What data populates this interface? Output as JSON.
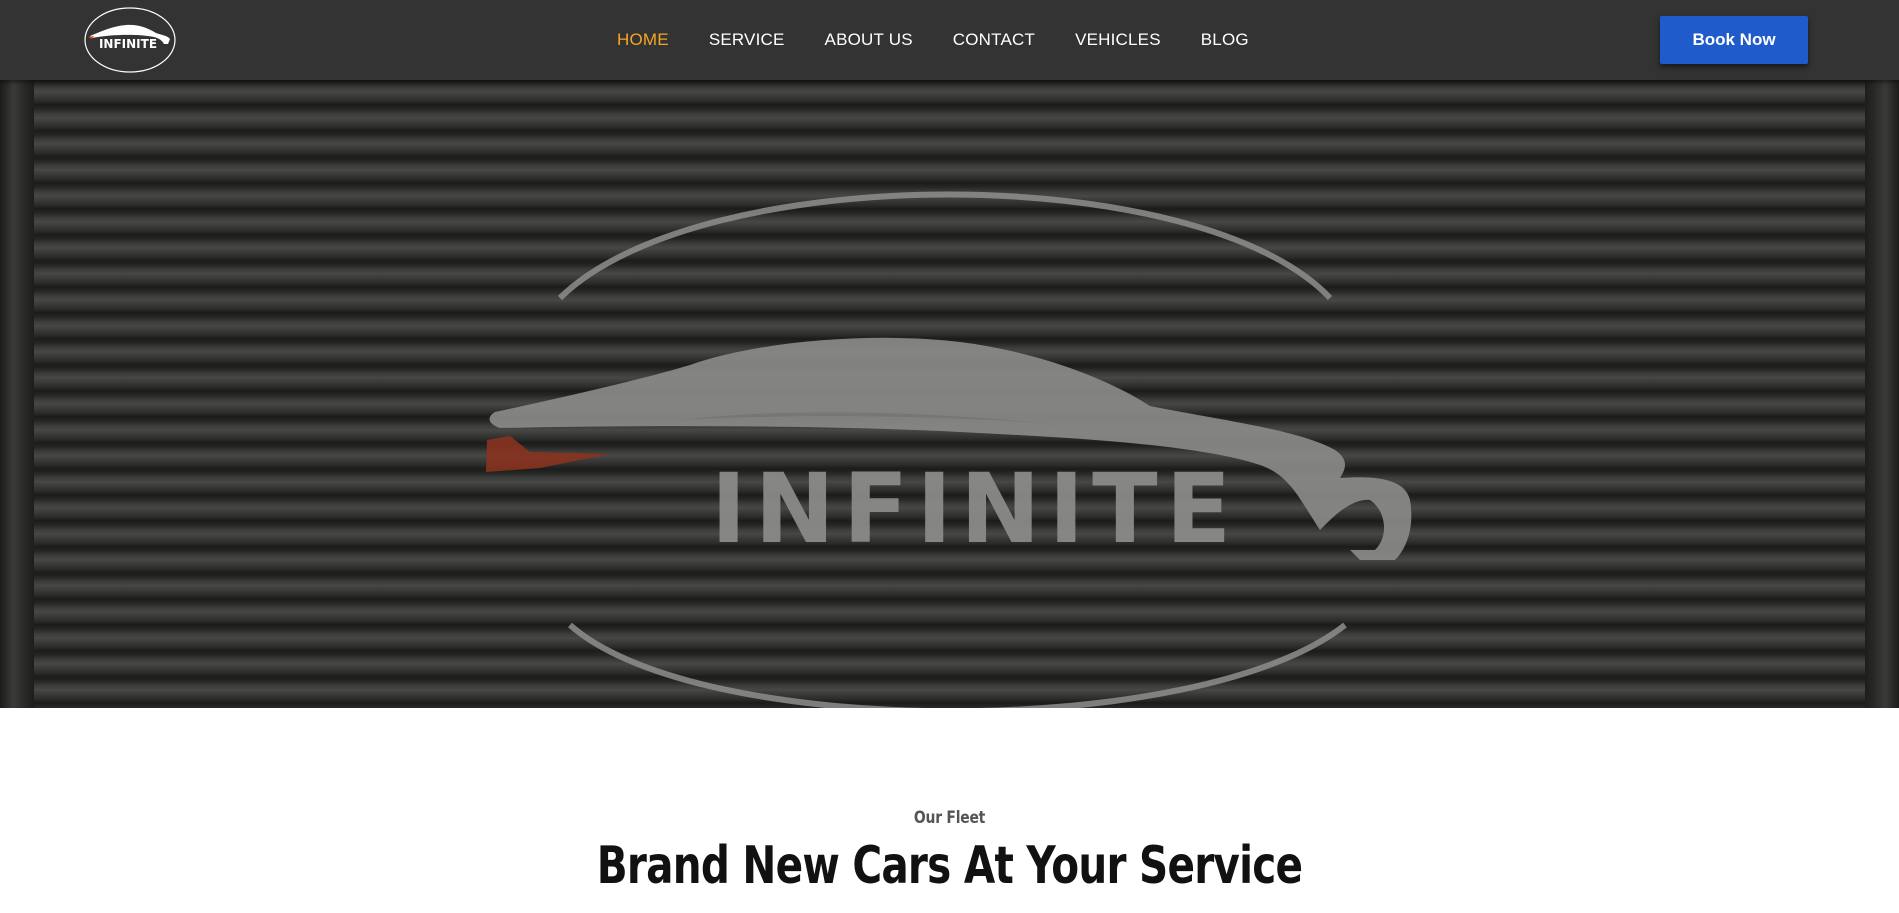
{
  "header": {
    "logo_text": "INFINITE",
    "nav": [
      {
        "label": "HOME",
        "active": true
      },
      {
        "label": "SERVICE",
        "active": false
      },
      {
        "label": "ABOUT US",
        "active": false
      },
      {
        "label": "CONTACT",
        "active": false
      },
      {
        "label": "VEHICLES",
        "active": false
      },
      {
        "label": "BLOG",
        "active": false
      }
    ],
    "book_button": "Book Now"
  },
  "hero": {
    "logo_text": "INFINITE",
    "background": "garage-shutter"
  },
  "fleet": {
    "subtitle": "Our Fleet",
    "title": "Brand New Cars At Your Service"
  },
  "colors": {
    "header_bg": "#333333",
    "nav_active": "#f5a623",
    "nav_text": "#ffffff",
    "button_bg": "#1f5bcb"
  },
  "icons": {
    "logo": "car-silhouette-logo"
  }
}
